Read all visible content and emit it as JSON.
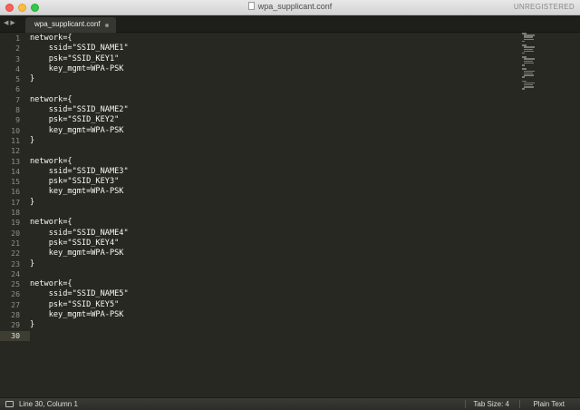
{
  "window": {
    "title": "wpa_supplicant.conf",
    "license_status": "UNREGISTERED"
  },
  "tabs": [
    {
      "label": "wpa_supplicant.conf",
      "active": true
    }
  ],
  "editor": {
    "current_line": 30,
    "lines": [
      "network={",
      "    ssid=\"SSID_NAME1\"",
      "    psk=\"SSID_KEY1\"",
      "    key_mgmt=WPA-PSK",
      "}",
      "",
      "network={",
      "    ssid=\"SSID_NAME2\"",
      "    psk=\"SSID_KEY2\"",
      "    key_mgmt=WPA-PSK",
      "}",
      "",
      "network={",
      "    ssid=\"SSID_NAME3\"",
      "    psk=\"SSID_KEY3\"",
      "    key_mgmt=WPA-PSK",
      "}",
      "",
      "network={",
      "    ssid=\"SSID_NAME4\"",
      "    psk=\"SSID_KEY4\"",
      "    key_mgmt=WPA-PSK",
      "}",
      "",
      "network={",
      "    ssid=\"SSID_NAME5\"",
      "    psk=\"SSID_KEY5\"",
      "    key_mgmt=WPA-PSK",
      "}",
      ""
    ]
  },
  "statusbar": {
    "position": "Line 30, Column 1",
    "tab_size": "Tab Size: 4",
    "syntax": "Plain Text"
  },
  "colors": {
    "editor_bg": "#272822",
    "text": "#f8f8f2",
    "line_numbers": "#8f908a"
  },
  "icons": {
    "nav": "chevron-left-right-icon",
    "panel": "panel-toggle-icon",
    "document": "document-icon"
  }
}
